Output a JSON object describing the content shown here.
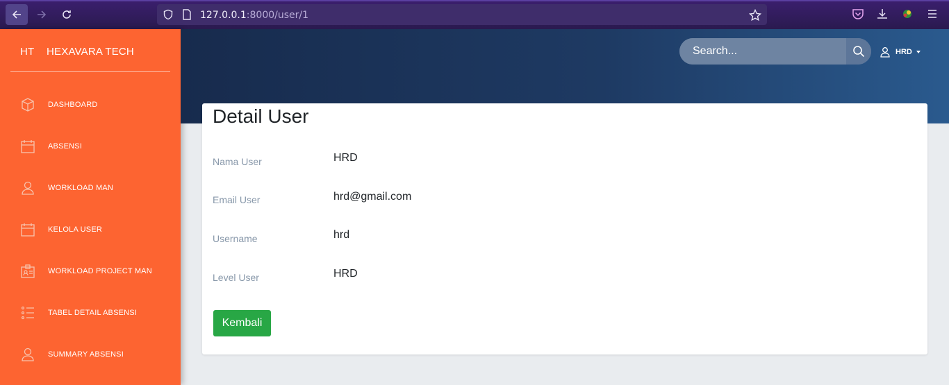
{
  "browser": {
    "url_host": "127.0.0.1",
    "url_rest": ":8000/user/1"
  },
  "sidebar": {
    "brand_short": "HT",
    "brand_name": "HEXAVARA TECH",
    "items": [
      {
        "label": "DASHBOARD",
        "icon": "cube-icon"
      },
      {
        "label": "ABSENSI",
        "icon": "calendar-icon"
      },
      {
        "label": "WORKLOAD MAN",
        "icon": "user-icon"
      },
      {
        "label": "KELOLA USER",
        "icon": "calendar-icon"
      },
      {
        "label": "WORKLOAD PROJECT MAN",
        "icon": "id-card-icon"
      },
      {
        "label": "TABEL DETAIL ABSENSI",
        "icon": "list-icon"
      },
      {
        "label": "SUMMARY ABSENSI",
        "icon": "user-icon"
      }
    ]
  },
  "header": {
    "search_placeholder": "Search...",
    "user_label": "HRD"
  },
  "card": {
    "title": "Detail User",
    "fields": [
      {
        "label": "Nama User",
        "value": "HRD"
      },
      {
        "label": "Email User",
        "value": "hrd@gmail.com"
      },
      {
        "label": "Username",
        "value": "hrd"
      },
      {
        "label": "Level User",
        "value": "HRD"
      }
    ],
    "back_button": "Kembali"
  },
  "colors": {
    "sidebar": "#fd6431",
    "header_start": "#172b4d",
    "header_end": "#2a5a8e",
    "button": "#28a745"
  }
}
